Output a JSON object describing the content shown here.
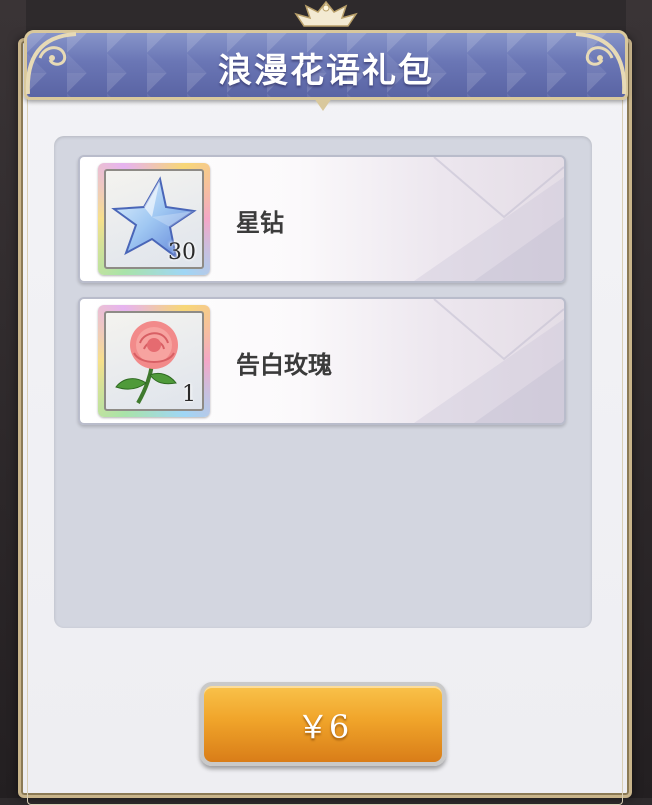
{
  "dialog": {
    "title": "浪漫花语礼包"
  },
  "items": [
    {
      "name": "星钻",
      "quantity": "30",
      "icon": "star-diamond-icon"
    },
    {
      "name": "告白玫瑰",
      "quantity": "1",
      "icon": "rose-icon"
    }
  ],
  "purchase": {
    "price_label": "￥6"
  },
  "colors": {
    "header_blue": "#6a76b5",
    "button_orange": "#f0a42a",
    "gold_border": "#d9c89c",
    "list_bg": "#d3d6e0"
  }
}
